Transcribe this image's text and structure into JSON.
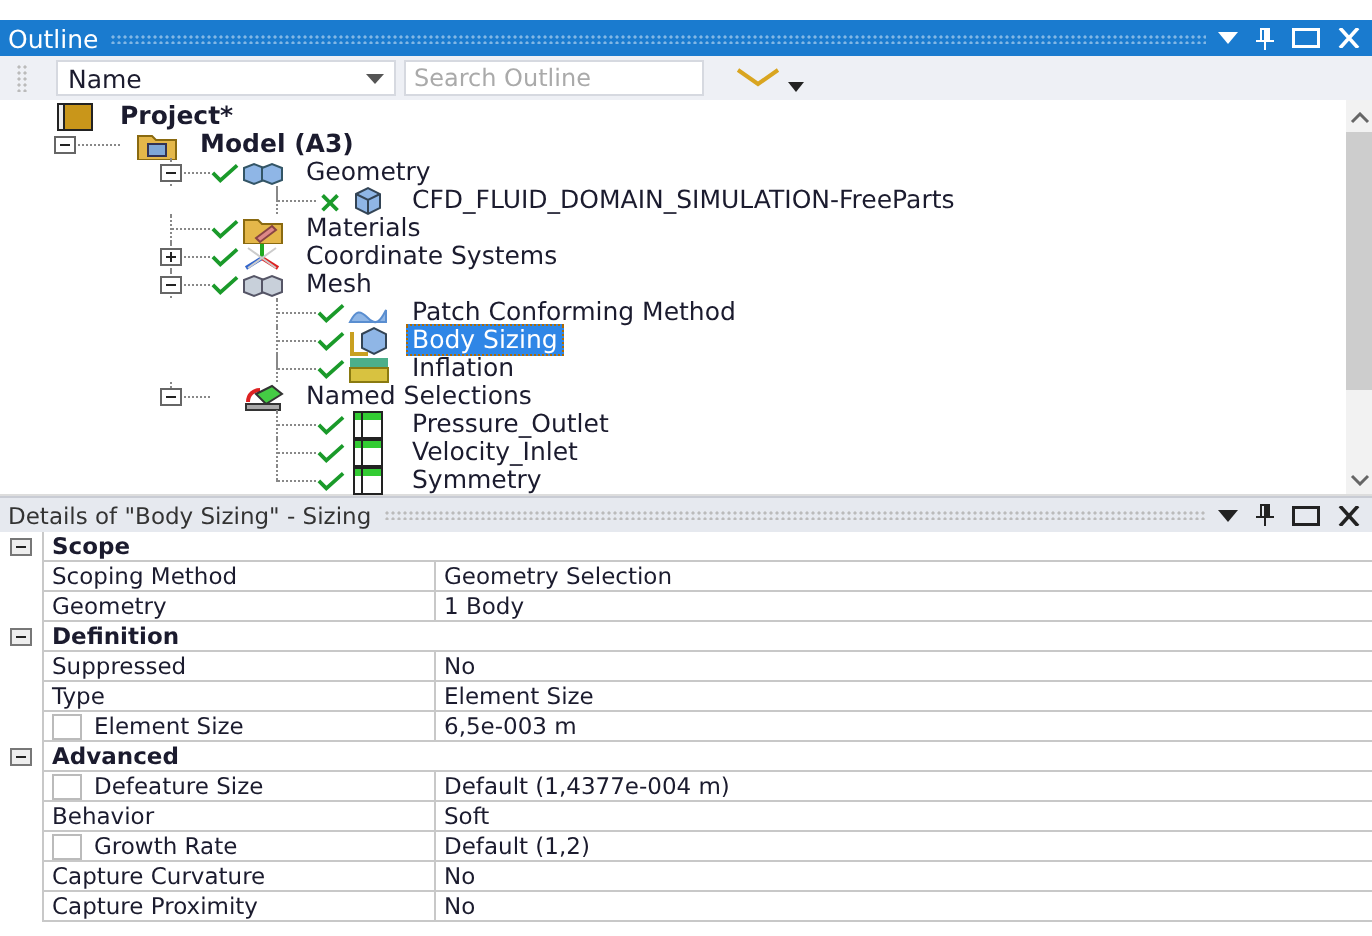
{
  "outline": {
    "title": "Outline",
    "toolbar": {
      "column_filter": "Name",
      "search": {
        "placeholder": "Search Outline"
      }
    },
    "tree": [
      {
        "label": "Project*",
        "kind": "project",
        "bold": true,
        "selected": false,
        "children": [
          {
            "label": "Model (A3)",
            "kind": "model",
            "bold": true,
            "expanded": true,
            "selected": false,
            "children": [
              {
                "label": "Geometry",
                "kind": "geometry",
                "status": {
                  "kind": "check"
                },
                "expanded": true,
                "selected": false,
                "children": [
                  {
                    "label": "CFD_FLUID_DOMAIN_SIMULATION-FreeParts",
                    "kind": "part",
                    "status": {
                      "kind": "cross"
                    },
                    "selected": false
                  }
                ]
              },
              {
                "label": "Materials",
                "kind": "materials",
                "status": {
                  "kind": "check"
                },
                "selected": false
              },
              {
                "label": "Coordinate Systems",
                "kind": "coordinates",
                "status": {
                  "kind": "check"
                },
                "expanded": false,
                "selected": false
              },
              {
                "label": "Mesh",
                "kind": "mesh",
                "status": {
                  "kind": "check"
                },
                "expanded": true,
                "selected": false,
                "children": [
                  {
                    "label": "Patch Conforming Method",
                    "kind": "method",
                    "status": {
                      "kind": "check"
                    },
                    "selected": false
                  },
                  {
                    "label": "Body Sizing",
                    "kind": "sizing",
                    "status": {
                      "kind": "check"
                    },
                    "selected": true
                  },
                  {
                    "label": "Inflation",
                    "kind": "inflation",
                    "status": {
                      "kind": "check"
                    },
                    "selected": false
                  }
                ]
              },
              {
                "label": "Named Selections",
                "kind": "named",
                "expanded": true,
                "selected": false,
                "children": [
                  {
                    "label": "Pressure_Outlet",
                    "kind": "selection",
                    "status": {
                      "kind": "check"
                    },
                    "selected": false
                  },
                  {
                    "label": "Velocity_Inlet",
                    "kind": "selection",
                    "status": {
                      "kind": "check"
                    },
                    "selected": false
                  },
                  {
                    "label": "Symmetry",
                    "kind": "selection",
                    "status": {
                      "kind": "check"
                    },
                    "selected": false
                  }
                ]
              }
            ]
          }
        ]
      }
    ]
  },
  "details": {
    "title": "Details of \"Body Sizing\" - Sizing",
    "groups": [
      {
        "name": "Scope",
        "expanded": true,
        "rows": [
          {
            "label": "Scoping Method",
            "value": "Geometry Selection"
          },
          {
            "label": "Geometry",
            "value": "1 Body"
          }
        ]
      },
      {
        "name": "Definition",
        "expanded": true,
        "rows": [
          {
            "label": "Suppressed",
            "value": "No"
          },
          {
            "label": "Type",
            "value": "Element Size"
          },
          {
            "label": "Element Size",
            "value": "6,5e-003 m",
            "checked": false
          }
        ]
      },
      {
        "name": "Advanced",
        "expanded": true,
        "rows": [
          {
            "label": "Defeature Size",
            "value": "Default (1,4377e-004 m)",
            "checked": false
          },
          {
            "label": "Behavior",
            "value": "Soft"
          },
          {
            "label": "Growth Rate",
            "value": "Default (1,2)",
            "checked": false
          },
          {
            "label": "Capture Curvature",
            "value": "No"
          },
          {
            "label": "Capture Proximity",
            "value": "No"
          }
        ]
      }
    ]
  }
}
